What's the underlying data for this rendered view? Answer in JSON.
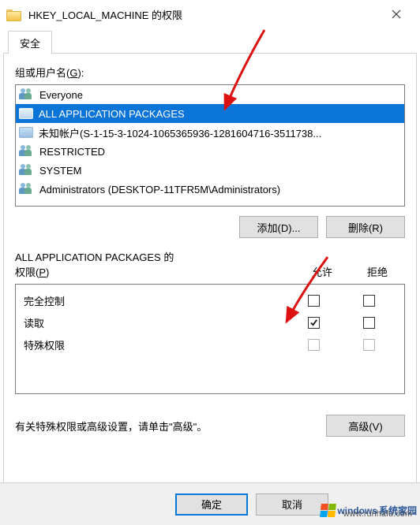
{
  "window": {
    "title": "HKEY_LOCAL_MACHINE 的权限"
  },
  "tab": {
    "security": "安全"
  },
  "group_label_pre": "组或用户名(",
  "group_label_u": "G",
  "group_label_post": "):",
  "principals": [
    {
      "name": "Everyone",
      "icon": "group"
    },
    {
      "name": "ALL APPLICATION PACKAGES",
      "icon": "pkg",
      "selected": true
    },
    {
      "name": "未知帐户(S-1-15-3-1024-1065365936-1281604716-3511738...",
      "icon": "pkg"
    },
    {
      "name": "RESTRICTED",
      "icon": "group"
    },
    {
      "name": "SYSTEM",
      "icon": "group"
    },
    {
      "name": "Administrators (DESKTOP-11TFR5M\\Administrators)",
      "icon": "group"
    }
  ],
  "buttons": {
    "add": "添加(D)...",
    "remove": "删除(R)",
    "advanced": "高级(V)",
    "ok": "确定",
    "cancel": "取消"
  },
  "perm_header": {
    "label_line1": "ALL APPLICATION PACKAGES 的",
    "label_line2_pre": "权限(",
    "label_line2_u": "P",
    "label_line2_post": ")",
    "allow": "允许",
    "deny": "拒绝"
  },
  "permissions": [
    {
      "name": "完全控制",
      "allow": false,
      "deny": false,
      "enabled": true
    },
    {
      "name": "读取",
      "allow": true,
      "deny": false,
      "enabled": true
    },
    {
      "name": "特殊权限",
      "allow": false,
      "deny": false,
      "enabled": false
    }
  ],
  "advanced_text": "有关特殊权限或高级设置，请单击\"高级\"。",
  "watermark": {
    "brand": "windows",
    "sub": "系统家园",
    "url": "www.runhafu.com"
  }
}
